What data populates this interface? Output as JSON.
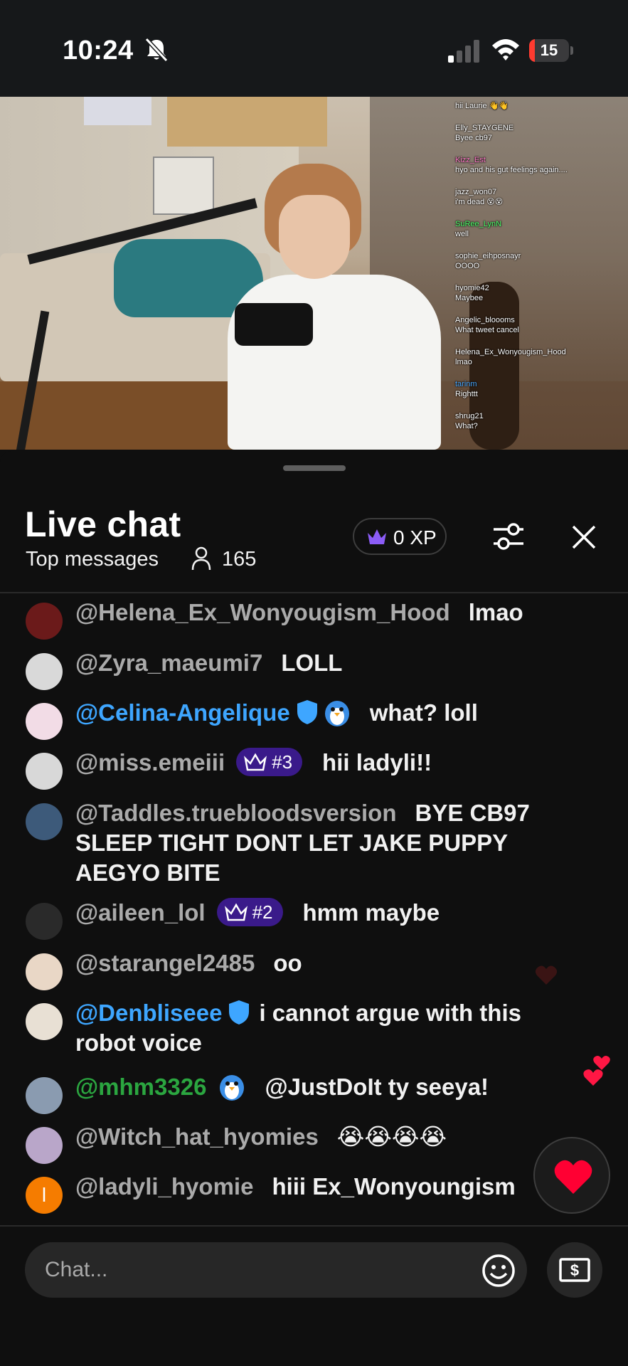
{
  "status_bar": {
    "time": "10:24",
    "battery_level": "15",
    "battery_fraction": 0.15
  },
  "video_overlay_chat": [
    {
      "name": "",
      "text": "hii Laurie 👋👋"
    },
    {
      "name": "Elly_STAYGENE",
      "text": "Byee cb97"
    },
    {
      "name": "Kizz_Est",
      "text": "hyo and his gut feelings again...."
    },
    {
      "name": "jazz_won07",
      "text": "i'm dead 😵😵"
    },
    {
      "name": "SuRee_LynN",
      "text": "well"
    },
    {
      "name": "sophie_eihposnayr",
      "text": "OOOO"
    },
    {
      "name": "hyomie42",
      "text": "Maybee"
    },
    {
      "name": "Angelic_bloooms",
      "text": "What tweet cancel"
    },
    {
      "name": "Helena_Ex_Wonyougism_Hood",
      "text": "lmao"
    },
    {
      "name": "tarinm",
      "text": "Righttt"
    },
    {
      "name": "shrug21",
      "text": "What?"
    }
  ],
  "panel": {
    "title": "Live chat",
    "subtitle": "Top messages",
    "viewer_count": "165",
    "xp_label": "0 XP"
  },
  "messages": [
    {
      "author": "@Helena_Ex_Wonyougism_Hood",
      "text": "lmao",
      "author_color": "gray"
    },
    {
      "author": "@Zyra_maeumi7",
      "text": "LOLL",
      "author_color": "gray"
    },
    {
      "author": "@Celina-Angelique",
      "text": "what? loll",
      "author_color": "blue",
      "badges": [
        "shield-icon",
        "penguin-emoji"
      ]
    },
    {
      "author": "@miss.emeiii",
      "text": "hii ladyli!!",
      "author_color": "gray",
      "rank": "#3"
    },
    {
      "author": "@Taddles.truebloodsversion",
      "text": "BYE CB97 SLEEP TIGHT DONT LET JAKE PUPPY AEGYO BITE",
      "author_color": "gray"
    },
    {
      "author": "@aileen_lol",
      "text": "hmm maybe",
      "author_color": "gray",
      "rank": "#2"
    },
    {
      "author": "@starangel2485",
      "text": "oo",
      "author_color": "gray"
    },
    {
      "author": "@Denbliseee",
      "text": "i cannot argue with this robot voice",
      "author_color": "blue",
      "badges": [
        "shield-icon"
      ]
    },
    {
      "author": "@mhm3326",
      "text": "@JustDoIt ty seeya!",
      "author_color": "green",
      "badges": [
        "penguin-emoji"
      ]
    },
    {
      "author": "@Witch_hat_hyomies",
      "text": "😭😭😭😭",
      "author_color": "gray"
    },
    {
      "author": "@ladyli_hyomie",
      "text": "hiii Ex_Wonyoungism",
      "author_color": "gray",
      "avatar_letter": "l"
    }
  ],
  "composer": {
    "placeholder": "Chat..."
  },
  "colors": {
    "background": "#0f0f0f",
    "author_gray": "#aaaaaa",
    "author_blue": "#3ea6ff",
    "author_green": "#2ba640",
    "rank_badge": "#3a1a8a",
    "battery_low": "#ff3b30",
    "heart": "#ff0033"
  }
}
